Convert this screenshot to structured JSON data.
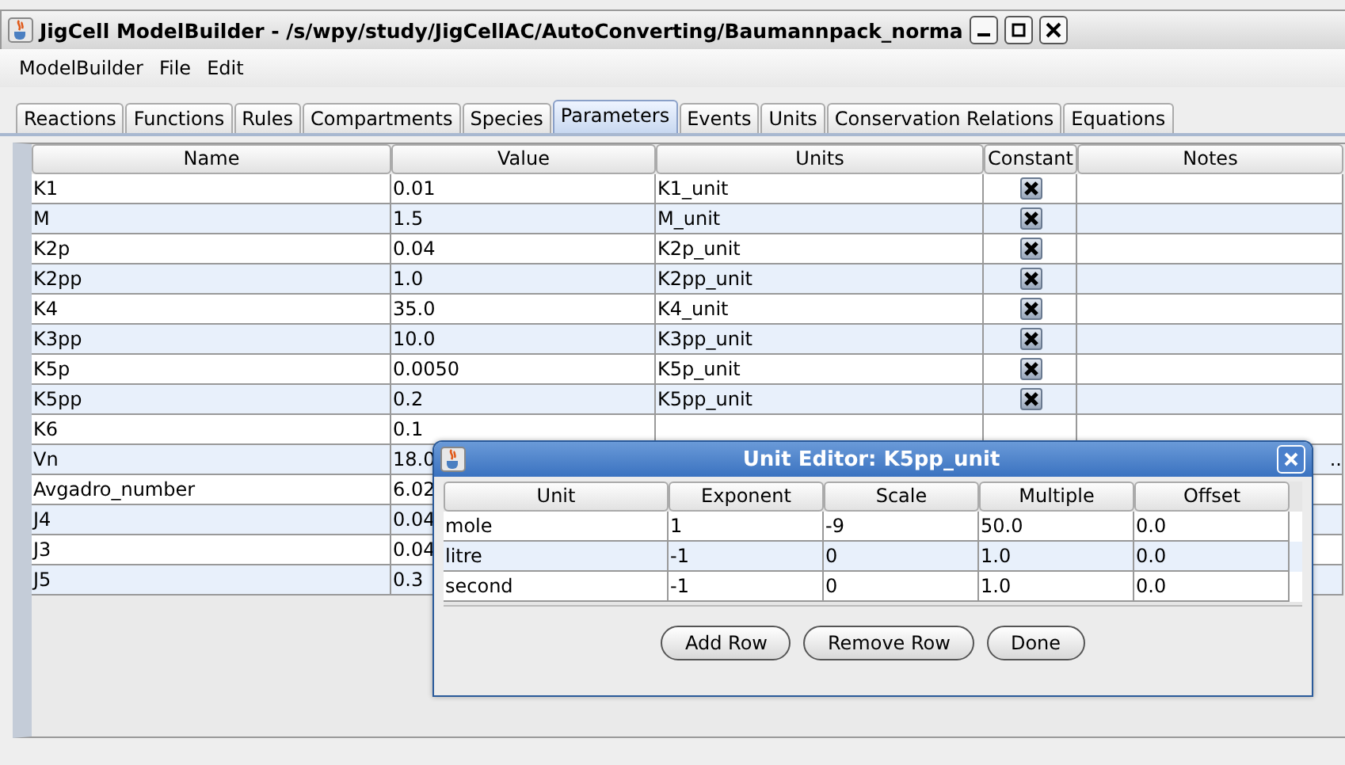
{
  "window": {
    "title": "JigCell ModelBuilder - /s/wpy/study/JigCellAC/AutoConverting/Baumannpack_norma"
  },
  "menu": [
    "ModelBuilder",
    "File",
    "Edit"
  ],
  "tabs": [
    {
      "label": "Reactions",
      "selected": false
    },
    {
      "label": "Functions",
      "selected": false
    },
    {
      "label": "Rules",
      "selected": false
    },
    {
      "label": "Compartments",
      "selected": false
    },
    {
      "label": "Species",
      "selected": false
    },
    {
      "label": "Parameters",
      "selected": true
    },
    {
      "label": "Events",
      "selected": false
    },
    {
      "label": "Units",
      "selected": false
    },
    {
      "label": "Conservation Relations",
      "selected": false
    },
    {
      "label": "Equations",
      "selected": false
    }
  ],
  "table": {
    "columns": [
      "Name",
      "Value",
      "Units",
      "Constant",
      "Notes"
    ],
    "rows": [
      {
        "name": "K1",
        "value": "0.01",
        "units": "K1_unit",
        "constant": true
      },
      {
        "name": "M",
        "value": "1.5",
        "units": "M_unit",
        "constant": true
      },
      {
        "name": "K2p",
        "value": "0.04",
        "units": "K2p_unit",
        "constant": true
      },
      {
        "name": "K2pp",
        "value": "1.0",
        "units": "K2pp_unit",
        "constant": true
      },
      {
        "name": "K4",
        "value": "35.0",
        "units": "K4_unit",
        "constant": true
      },
      {
        "name": "K3pp",
        "value": "10.0",
        "units": "K3pp_unit",
        "constant": true
      },
      {
        "name": "K5p",
        "value": "0.0050",
        "units": "K5p_unit",
        "constant": true
      },
      {
        "name": "K5pp",
        "value": "0.2",
        "units": "K5pp_unit",
        "constant": true
      },
      {
        "name": "K6",
        "value": "0.1"
      },
      {
        "name": "Vn",
        "value": "18.0",
        "notes": ".."
      },
      {
        "name": "Avgadro_number",
        "value": "6.02"
      },
      {
        "name": "J4",
        "value": "0.04"
      },
      {
        "name": "J3",
        "value": "0.04"
      },
      {
        "name": "J5",
        "value": "0.3"
      }
    ]
  },
  "dialog": {
    "title": "Unit Editor: K5pp_unit",
    "columns": [
      "Unit",
      "Exponent",
      "Scale",
      "Multiple",
      "Offset"
    ],
    "rows": [
      [
        "mole",
        "1",
        "-9",
        "50.0",
        "0.0"
      ],
      [
        "litre",
        "-1",
        "0",
        "1.0",
        "0.0"
      ],
      [
        "second",
        "-1",
        "0",
        "1.0",
        "0.0"
      ]
    ],
    "buttons": [
      "Add Row",
      "Remove Row",
      "Done"
    ]
  }
}
